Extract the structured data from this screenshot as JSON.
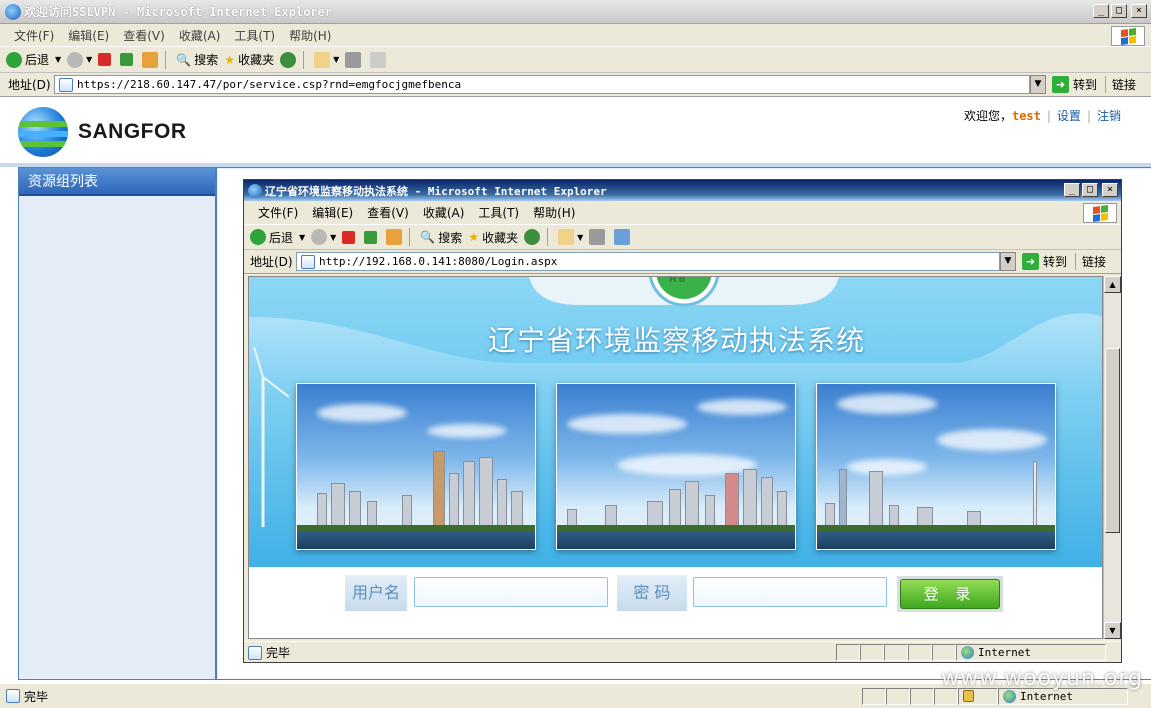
{
  "outer_window": {
    "title": "欢迎访问SSLVPN - Microsoft Internet Explorer",
    "controls": [
      "_",
      "□",
      "×"
    ]
  },
  "outer_menu": [
    "文件(F)",
    "编辑(E)",
    "查看(V)",
    "收藏(A)",
    "工具(T)",
    "帮助(H)"
  ],
  "outer_toolbar": {
    "back": "后退",
    "search": "搜索",
    "favorites": "收藏夹"
  },
  "outer_address": {
    "label": "地址(D)",
    "url": "https://218.60.147.47/por/service.csp?rnd=emgfocjgmefbenca",
    "go": "转到",
    "links": "链接"
  },
  "sangfor": {
    "brand": "SANGFOR",
    "welcome": "欢迎您，",
    "username": "test",
    "settings": "设置",
    "logout": "注销",
    "sidebar_title": "资源组列表"
  },
  "inner_window": {
    "title": "辽宁省环境监察移动执法系统 - Microsoft Internet Explorer",
    "controls": [
      "_",
      "□",
      "×"
    ],
    "menu": [
      "文件(F)",
      "编辑(E)",
      "查看(V)",
      "收藏(A)",
      "工具(T)",
      "帮助(H)"
    ],
    "toolbar": {
      "back": "后退",
      "search": "搜索",
      "favorites": "收藏夹"
    },
    "address": {
      "label": "地址(D)",
      "url": "http://192.168.0.141:8080/Login.aspx",
      "go": "转到",
      "links": "链接"
    },
    "page": {
      "system_title": "辽宁省环境监察移动执法系统",
      "badge": "HB",
      "username_label": "用户名",
      "password_label": "密 码",
      "login_button": "登 录"
    },
    "status": {
      "text": "完毕",
      "zone": "Internet"
    }
  },
  "outer_status": {
    "text": "完毕",
    "zone": "Internet"
  },
  "watermark": "www.wooyun.org"
}
